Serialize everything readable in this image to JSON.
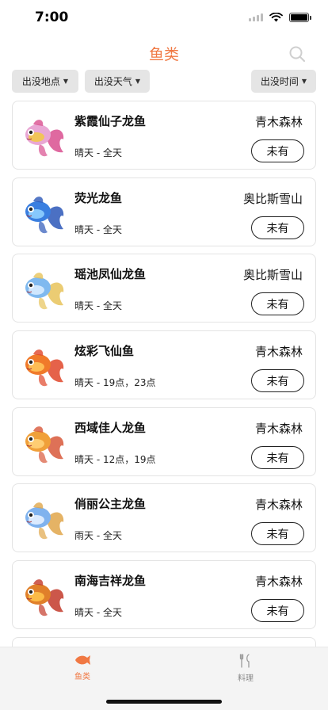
{
  "status_bar": {
    "time": "7:00"
  },
  "nav": {
    "title": "鱼类",
    "search_icon": "search-icon"
  },
  "filters": {
    "location": "出没地点",
    "weather": "出没天气",
    "time": "出没时间"
  },
  "fish": [
    {
      "name": "紫霞仙子龙鱼",
      "location": "青木森林",
      "time": "晴天 - 全天",
      "status": "未有",
      "colors": [
        "#e9a7d4",
        "#f2c84a",
        "#d94f8f"
      ]
    },
    {
      "name": "荧光龙鱼",
      "location": "奥比斯雪山",
      "time": "晴天 - 全天",
      "status": "未有",
      "colors": [
        "#3a7fe0",
        "#8fd0ff",
        "#2c57b8"
      ]
    },
    {
      "name": "瑶池凤仙龙鱼",
      "location": "奥比斯雪山",
      "time": "晴天 - 全天",
      "status": "未有",
      "colors": [
        "#7fb9ef",
        "#d8ecff",
        "#e7c35a"
      ]
    },
    {
      "name": "炫彩飞仙鱼",
      "location": "青木森林",
      "time": "晴天 - 19点，23点",
      "status": "未有",
      "colors": [
        "#f07a2a",
        "#ffc45a",
        "#e0462a"
      ]
    },
    {
      "name": "西域佳人龙鱼",
      "location": "青木森林",
      "time": "晴天 - 12点，19点",
      "status": "未有",
      "colors": [
        "#f0a03a",
        "#ffd27a",
        "#d8583a"
      ]
    },
    {
      "name": "俏丽公主龙鱼",
      "location": "青木森林",
      "time": "雨天 - 全天",
      "status": "未有",
      "colors": [
        "#7fb2ee",
        "#e6f0ff",
        "#e0a64a"
      ]
    },
    {
      "name": "南海吉祥龙鱼",
      "location": "青木森林",
      "time": "晴天 - 全天",
      "status": "未有",
      "colors": [
        "#e0802a",
        "#ffc14a",
        "#c33a2a"
      ]
    }
  ],
  "tabs": [
    {
      "label": "鱼类",
      "icon": "fish-icon",
      "active": true,
      "color": "#f07843"
    },
    {
      "label": "料理",
      "icon": "cooking-icon",
      "active": false,
      "color": "#8a8a8a"
    }
  ]
}
